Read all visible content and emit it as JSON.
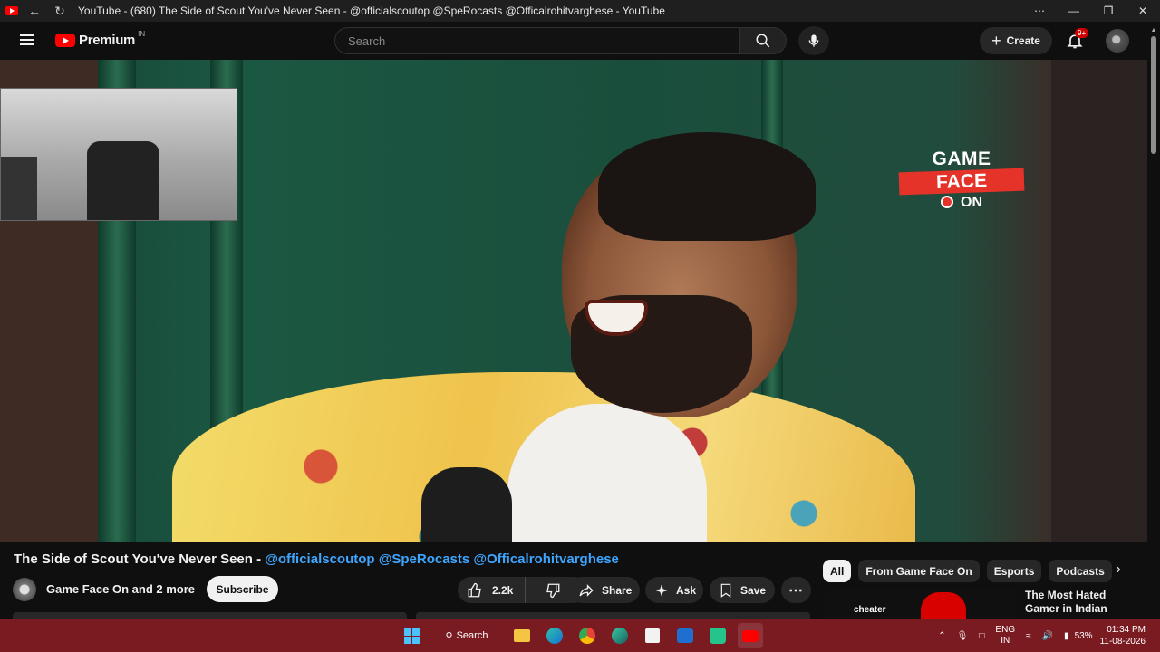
{
  "window": {
    "title": "YouTube - (680) The Side of Scout You've Never Seen - @officialscoutop @SpeRocasts @Officalrohitvarghese - YouTube",
    "controls": [
      "⋯",
      "—",
      "❐",
      "✕"
    ]
  },
  "header": {
    "logo_text": "Premium",
    "region": "IN",
    "search_placeholder": "Search",
    "create_label": "Create",
    "notification_count": "9+"
  },
  "video": {
    "brand_line1": "GAME",
    "brand_line2": "FACE",
    "brand_line3": "ON"
  },
  "details": {
    "title_main": "The Side of Scout You've Never Seen - ",
    "title_mentions": "@officialscoutop @SpeRocasts @Officalrohitvarghese",
    "channel_name": "Game Face On and 2 more",
    "subscribe_label": "Subscribe",
    "like_count": "2.2k",
    "share_label": "Share",
    "ask_label": "Ask",
    "save_label": "Save"
  },
  "chips": [
    "All",
    "From Game Face On",
    "Esports",
    "Podcasts"
  ],
  "recommendation": {
    "thumb_text": "cheater",
    "title": "The Most Hated Gamer in Indian History..."
  },
  "taskbar": {
    "search_label": "Search",
    "lang_top": "ENG",
    "lang_bottom": "IN",
    "battery": "53%",
    "time": "01:34 PM",
    "date": "11-08-2026"
  }
}
